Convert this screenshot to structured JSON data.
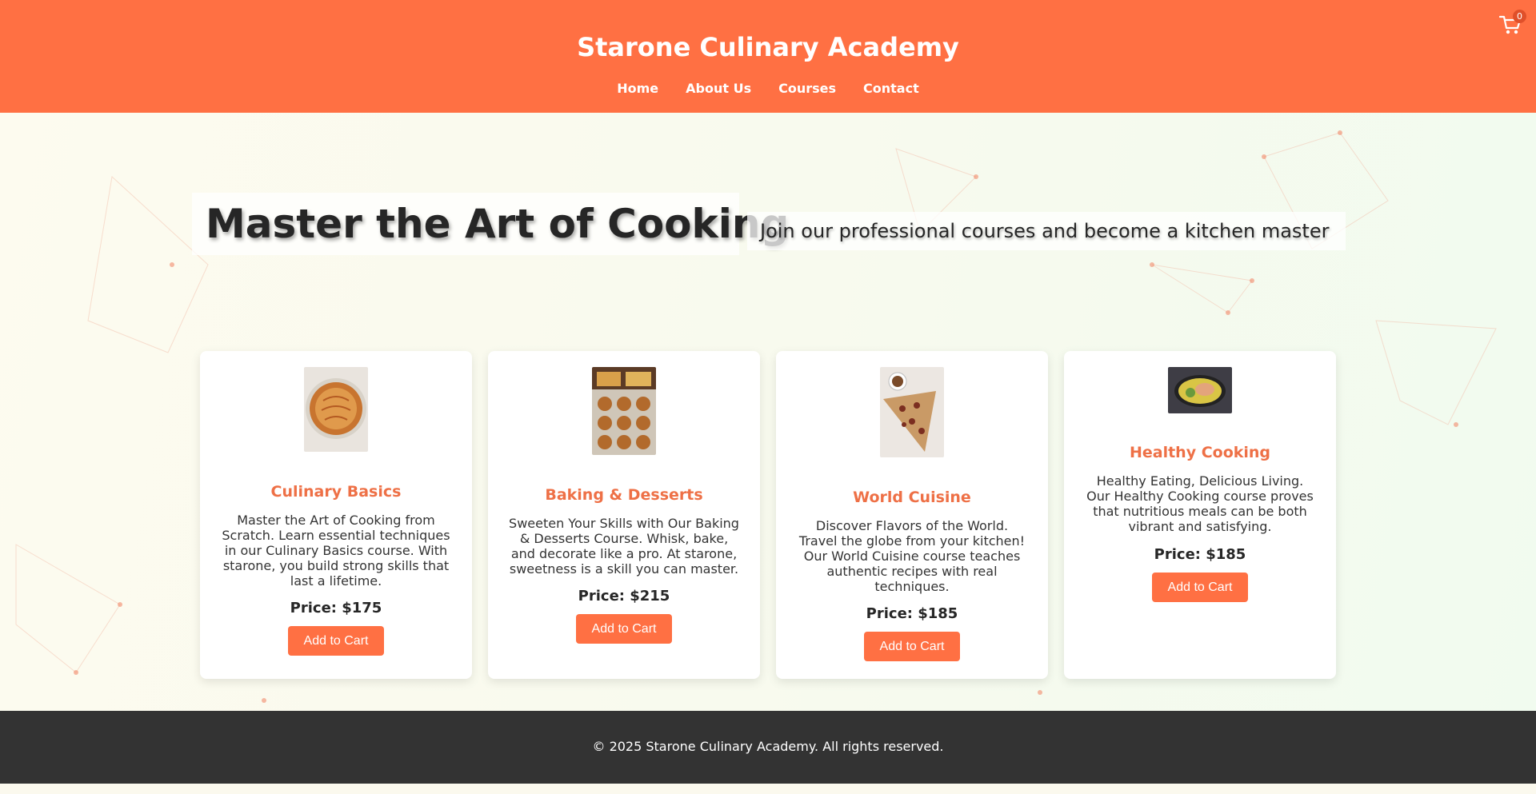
{
  "header": {
    "title": "Starone Culinary Academy",
    "nav": [
      "Home",
      "About Us",
      "Courses",
      "Contact"
    ],
    "cart_count": "0"
  },
  "hero": {
    "title": "Master the Art of Cooking",
    "subtitle": "Join our professional courses and become a kitchen master"
  },
  "courses": [
    {
      "title": "Culinary Basics",
      "description": "Master the Art of Cooking from Scratch. Learn essential techniques in our Culinary Basics course. With starone, you build strong skills that last a lifetime.",
      "price": "Price: $175",
      "button": "Add to Cart"
    },
    {
      "title": "Baking & Desserts",
      "description": "Sweeten Your Skills with Our Baking & Desserts Course. Whisk, bake, and decorate like a pro. At starone, sweetness is a skill you can master.",
      "price": "Price: $215",
      "button": "Add to Cart"
    },
    {
      "title": "World Cuisine",
      "description": "Discover Flavors of the World. Travel the globe from your kitchen! Our World Cuisine course teaches authentic recipes with real techniques.",
      "price": "Price: $185",
      "button": "Add to Cart"
    },
    {
      "title": "Healthy Cooking",
      "description": "Healthy Eating, Delicious Living. Our Healthy Cooking course proves that nutritious meals can be both vibrant and satisfying.",
      "price": "Price: $185",
      "button": "Add to Cart"
    }
  ],
  "footer": {
    "text": "© 2025 Starone Culinary Academy. All rights reserved."
  },
  "colors": {
    "accent": "#ff7043",
    "card_title": "#ee7046",
    "footer_bg": "#333333"
  },
  "icons": {
    "cart": "shopping-cart-icon"
  }
}
